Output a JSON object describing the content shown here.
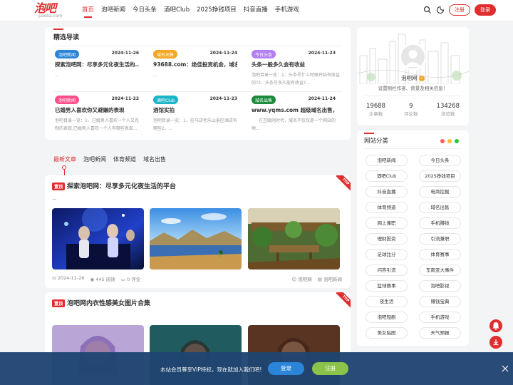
{
  "header": {
    "logo_text": "泡吧",
    "logo_sub": "paoba.com",
    "nav": [
      "首页",
      "泡吧新闻",
      "今日头条",
      "酒吧Club",
      "2025挣钱项目",
      "抖音直播",
      "手机游戏"
    ],
    "login": "注册",
    "register": "登录"
  },
  "featured": {
    "title": "精选导读",
    "cards": [
      {
        "tag": "泡吧新闻",
        "tag_color": "#2a84d8",
        "date": "2024-11-26",
        "title": "探索泡吧网：尽享多元化夜生活的...",
        "desc": "..."
      },
      {
        "tag": "域名出售",
        "tag_color": "#f5a623",
        "date": "2024-11-24",
        "title": "93688.com：绝佳投资机会，域名...",
        "desc": "..."
      },
      {
        "tag": "今日头条",
        "tag_color": "#b47ff3",
        "date": "2024-11-23",
        "title": "头条一般多久会有收益",
        "desc": "泡吧目录一览：1、头条号什么时候开始有收益的?2、头条号多久能有收益?..."
      },
      {
        "tag": "泡吧新闻",
        "tag_color": "#ff4f8b",
        "date": "2024-11-22",
        "title": "已婚男人喜欢你又避嫌的表现",
        "desc": "泡吧目录一览：1、已婚男人喜欢一个人又克制的表现,已婚男人喜欢一个人有哪些表现..."
      },
      {
        "tag": "酒吧Club",
        "tag_color": "#1bb5c9",
        "date": "2024-11-23",
        "title": "酒馆实拍",
        "desc": "泡吧目录一览：1、驻马店老乐山景区酒店有哪些2、..."
      },
      {
        "tag": "域名出售",
        "tag_color": "#1b8a3c",
        "date": "2024-11-24",
        "title": "www.yqms.com 超级域名出售，...",
        "desc": "在互联网时代，域名不仅仅是一个网站的地..."
      }
    ]
  },
  "tabs": [
    "最新文章",
    "泡吧新闻",
    "体育频道",
    "域名出售"
  ],
  "articles": [
    {
      "badge": "置顶",
      "title": "探索泡吧网：尽享多元化夜生活的平台",
      "excerpt": "...",
      "ribbon": "TOP",
      "date": "2024-11-26",
      "views": "445 阅读",
      "comments": "0 评论",
      "author": "泡吧网",
      "category": "泡吧新闻"
    },
    {
      "badge": "置顶",
      "title": "泡吧网内衣性感美女图片合集",
      "ribbon": "TOP"
    }
  ],
  "profile": {
    "name": "泡吧网",
    "desc": "设置侧栏作者、背景及相关信息！",
    "stats": [
      {
        "num": "19688",
        "label": "文章数"
      },
      {
        "num": "9",
        "label": "评论数"
      },
      {
        "num": "134268",
        "label": "浏览数"
      }
    ]
  },
  "categories": {
    "title": "网站分类",
    "items": [
      "泡吧新闻",
      "今日头条",
      "酒吧Club",
      "2025挣钱项目",
      "抖音直播",
      "电商挖掘",
      "体育频道",
      "域名出售",
      "网上兼职",
      "手机赚钱",
      "理财投资",
      "引流兼职",
      "足球比分",
      "体育赛事",
      "问答引流",
      "东南亚大事件",
      "篮球赛事",
      "泡吧影视",
      "夜生活",
      "赚钱宝典",
      "泡吧短剧",
      "手机游戏",
      "美女贴图",
      "天气预报"
    ]
  },
  "bottom_bar": {
    "text": "本站会员尊享VIP特权，现在就加入我们吧!",
    "login": "登录",
    "register": "注册"
  },
  "colors": {
    "accent": "#e02d2d",
    "bar": "#1f4571"
  }
}
